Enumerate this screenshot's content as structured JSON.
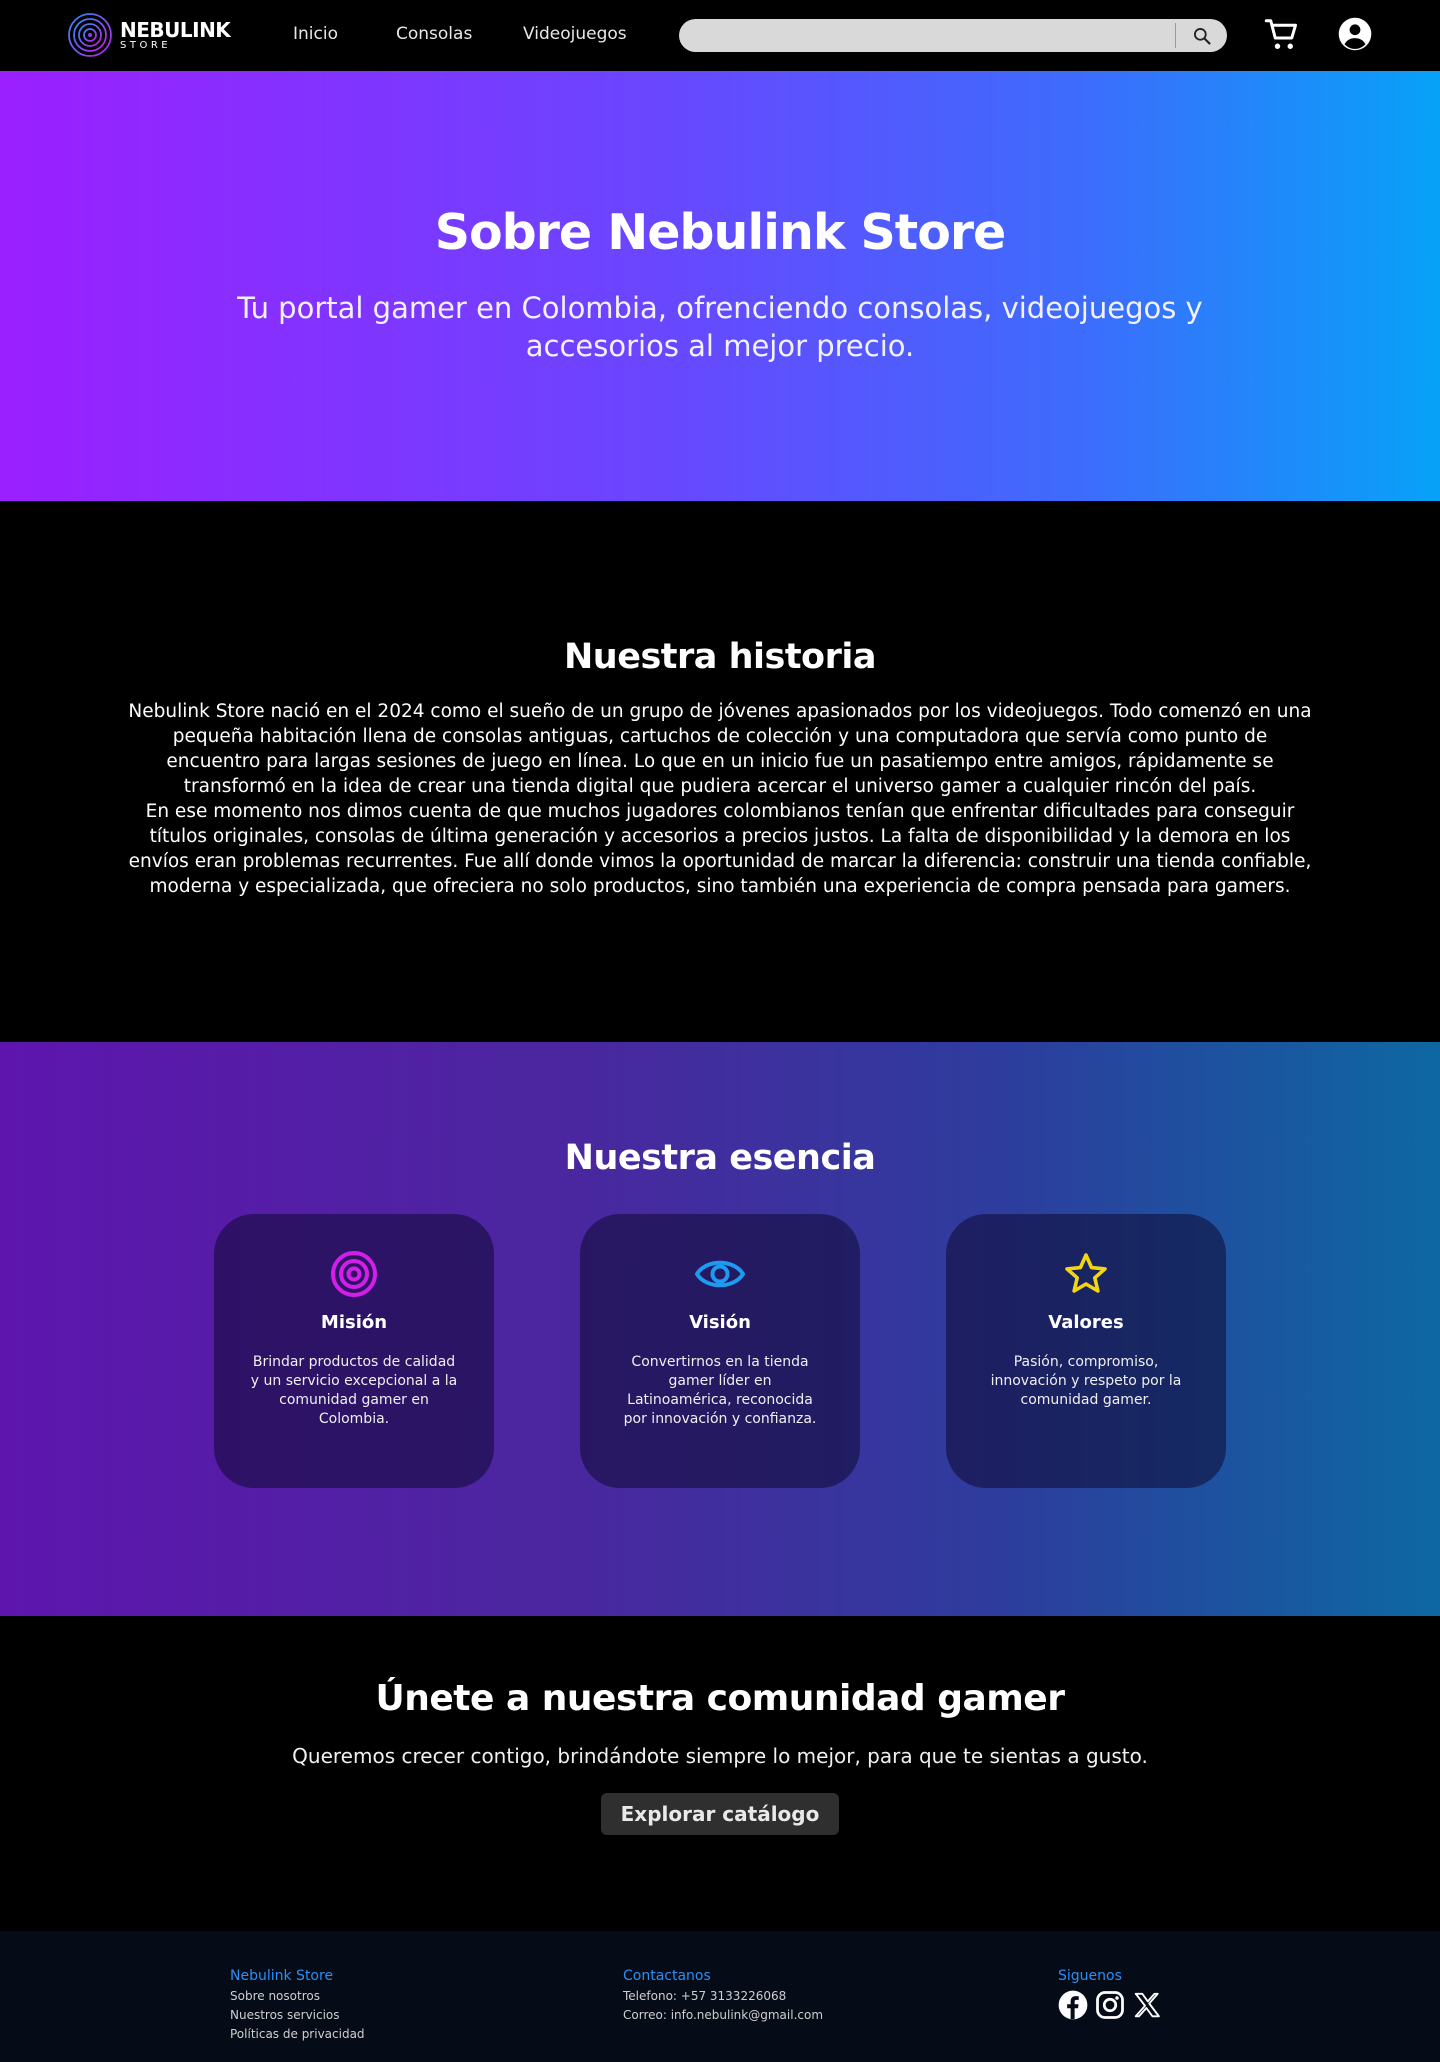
{
  "navbar": {
    "logo": {
      "name": "NEBULINK",
      "sub": "STORE"
    },
    "links": [
      "Inicio",
      "Consolas",
      "Videojuegos"
    ],
    "search": {
      "value": "",
      "placeholder": ""
    },
    "icons": [
      "search-icon",
      "cart-icon",
      "account-icon"
    ]
  },
  "hero": {
    "title": "Sobre Nebulink Store",
    "subtitle": "Tu portal gamer en Colombia, ofrenciendo consolas, videojuegos y accesorios al mejor precio."
  },
  "historia": {
    "title": "Nuestra historia",
    "paragraphs": [
      "Nebulink Store nació en el 2024 como el sueño de un grupo de jóvenes apasionados por los videojuegos. Todo comenzó en una pequeña habitación llena de consolas antiguas, cartuchos de colección y una computadora que servía como punto de encuentro para largas sesiones de juego en línea. Lo que en un inicio fue un pasatiempo entre amigos, rápidamente se transformó en la idea de crear una tienda digital que pudiera acercar el universo gamer a cualquier rincón del país.",
      "En ese momento nos dimos cuenta de que muchos jugadores colombianos tenían que enfrentar dificultades para conseguir títulos originales, consolas de última generación y accesorios a precios justos. La falta de disponibilidad y la demora en los envíos eran problemas recurrentes. Fue allí donde vimos la oportunidad de marcar la diferencia: construir una tienda confiable, moderna y especializada, que ofreciera no solo productos, sino también una experiencia de compra pensada para gamers."
    ]
  },
  "esencia": {
    "title": "Nuestra esencia",
    "cards": [
      {
        "icon": "target-icon",
        "color": "#d21ee6",
        "title": "Misión",
        "text": "Brindar productos de calidad y un servicio excepcional a la comunidad gamer en Colombia."
      },
      {
        "icon": "eye-icon",
        "color": "#1d9bf0",
        "title": "Visión",
        "text": "Convertirnos en la tienda gamer líder en Latinoamérica, reconocida por innovación y confianza."
      },
      {
        "icon": "star-icon",
        "color": "#f2d513",
        "title": "Valores",
        "text": "Pasión, compromiso, innovación y respeto por la comunidad gamer."
      }
    ]
  },
  "comunidad": {
    "title": "Únete a nuestra comunidad gamer",
    "subtitle": "Queremos crecer contigo, brindándote siempre lo mejor, para que te sientas a gusto.",
    "button": "Explorar catálogo"
  },
  "footer": {
    "col1": {
      "title": "Nebulink Store",
      "items": [
        "Sobre nosotros",
        "Nuestros servicios",
        "Políticas de privacidad"
      ]
    },
    "col2": {
      "title": "Contactanos",
      "items": [
        "Telefono: +57 3133226068",
        "Correo:  info.nebulink@gmail.com"
      ]
    },
    "col3": {
      "title": "Siguenos",
      "icons": [
        "facebook-icon",
        "instagram-icon",
        "x-icon"
      ]
    }
  },
  "colors": {
    "accent_blue": "#2b8ff5",
    "hero_gradient": [
      "#9b1fff",
      "#07a2f8"
    ],
    "esencia_gradient": [
      "#5e15ae",
      "#0d68a2"
    ]
  }
}
